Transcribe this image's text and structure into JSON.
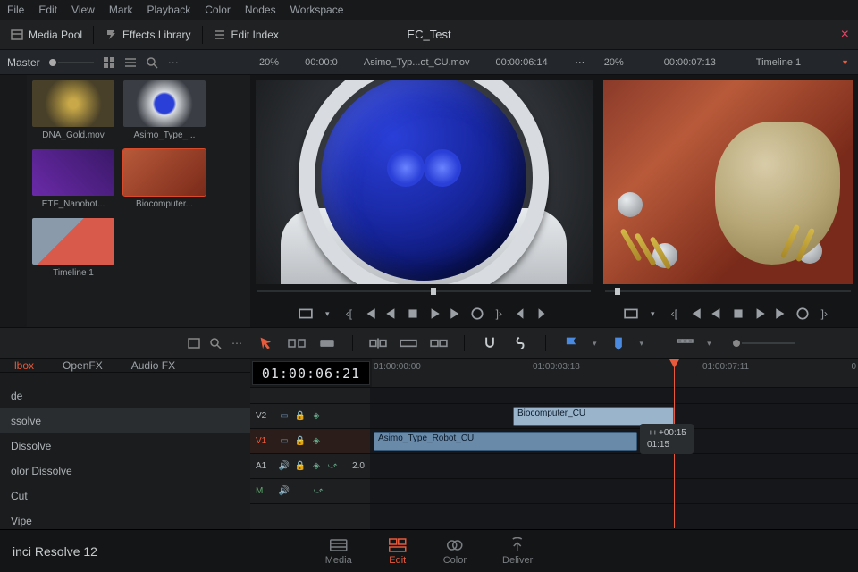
{
  "menu": {
    "items": [
      "File",
      "Edit",
      "View",
      "Mark",
      "Playback",
      "Color",
      "Nodes",
      "Workspace"
    ]
  },
  "toolbar": {
    "media_pool": "Media Pool",
    "effects_library": "Effects Library",
    "edit_index": "Edit Index",
    "project": "EC_Test"
  },
  "media": {
    "bin": "Master",
    "clips": [
      {
        "label": "DNA_Gold.mov",
        "style": "th-dna"
      },
      {
        "label": "Asimo_Type_...",
        "style": "th-robot"
      },
      {
        "label": "ETF_Nanobot...",
        "style": "th-nano"
      },
      {
        "label": "Biocomputer...",
        "style": "th-bio",
        "selected": true
      },
      {
        "label": "Timeline 1",
        "style": "th-tl",
        "tri": true
      }
    ]
  },
  "source_viewer": {
    "zoom": "20%",
    "pos": "00:00:0",
    "name": "Asimo_Typ...ot_CU.mov",
    "dur": "00:00:06:14"
  },
  "timeline_viewer": {
    "zoom": "20%",
    "pos": "00:00:07:13",
    "name": "Timeline 1"
  },
  "effects": {
    "tabs": [
      "lbox",
      "OpenFX",
      "Audio FX"
    ],
    "items": [
      "de",
      "ssolve",
      " Dissolve",
      "olor Dissolve",
      "Cut",
      "Vipe"
    ]
  },
  "timeline": {
    "timecode": "01:00:06:21",
    "ruler": [
      "01:00:00:00",
      "01:00:03:18",
      "01:00:07:11",
      "0"
    ],
    "tracks": {
      "v2": "V2",
      "v1": "V1",
      "a1": "A1",
      "m": "M",
      "a1_val": "2.0"
    },
    "clips": {
      "v2": "Biocomputer_CU",
      "v1": "Asimo_Type_Robot_CU"
    },
    "trim": {
      "delta": "+00:15",
      "total": "01:15"
    }
  },
  "bottom": {
    "app": "inci Resolve 12",
    "tabs": [
      "Media",
      "Edit",
      "Color",
      "Deliver"
    ]
  }
}
